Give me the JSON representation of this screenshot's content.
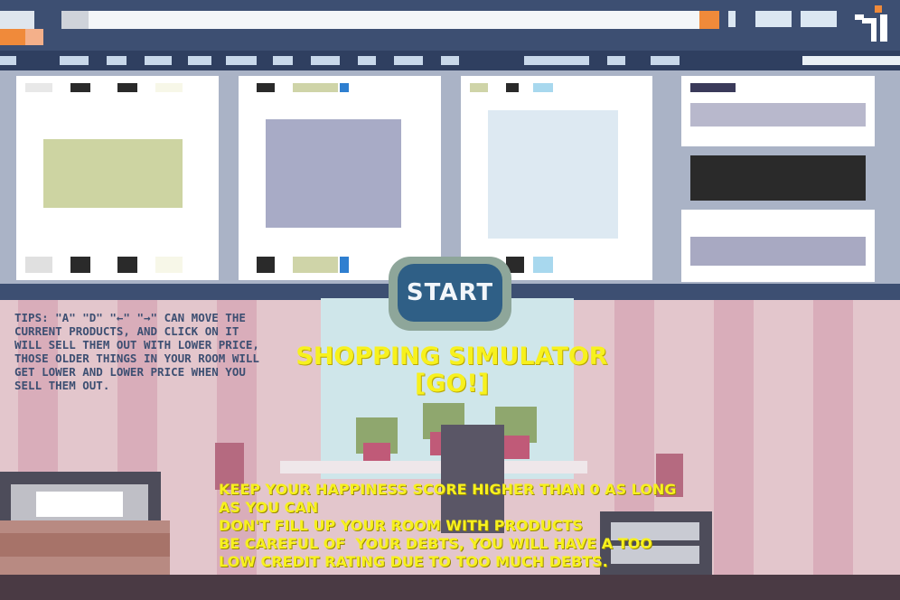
{
  "app": {
    "start_label": "START",
    "title_line1": "SHOPPING SIMULATOR",
    "title_line2": "[GO!]"
  },
  "tips": "TIPS: \"A\" \"D\" \"←\" \"→\" CAN MOVE THE CURRENT PRODUCTS, AND CLICK ON IT WILL SELL THEM OUT WITH LOWER PRICE, THOSE OLDER THINGS IN YOUR ROOM WILL GET LOWER AND LOWER PRICE WHEN YOU SELL THEM OUT.",
  "rules": [
    "KEEP YOUR HAPPINESS SCORE HIGHER THAN 0 AS LONG AS YOU CAN",
    "DON'T FILL UP YOUR ROOM WITH PRODUCTS",
    "BE CAREFUL OF  YOUR DEBTS, YOU WILL HAVE A TOO LOW CREDIT RATING DUE TO TOO MUCH DEBTS."
  ],
  "colors": {
    "accent_text": "#f7f11e",
    "start_button": "#2f5f86",
    "tips_text": "#3d4f72",
    "browser_bar": "#3d4f72"
  },
  "icons": {
    "logo": "site-logo-icon"
  }
}
